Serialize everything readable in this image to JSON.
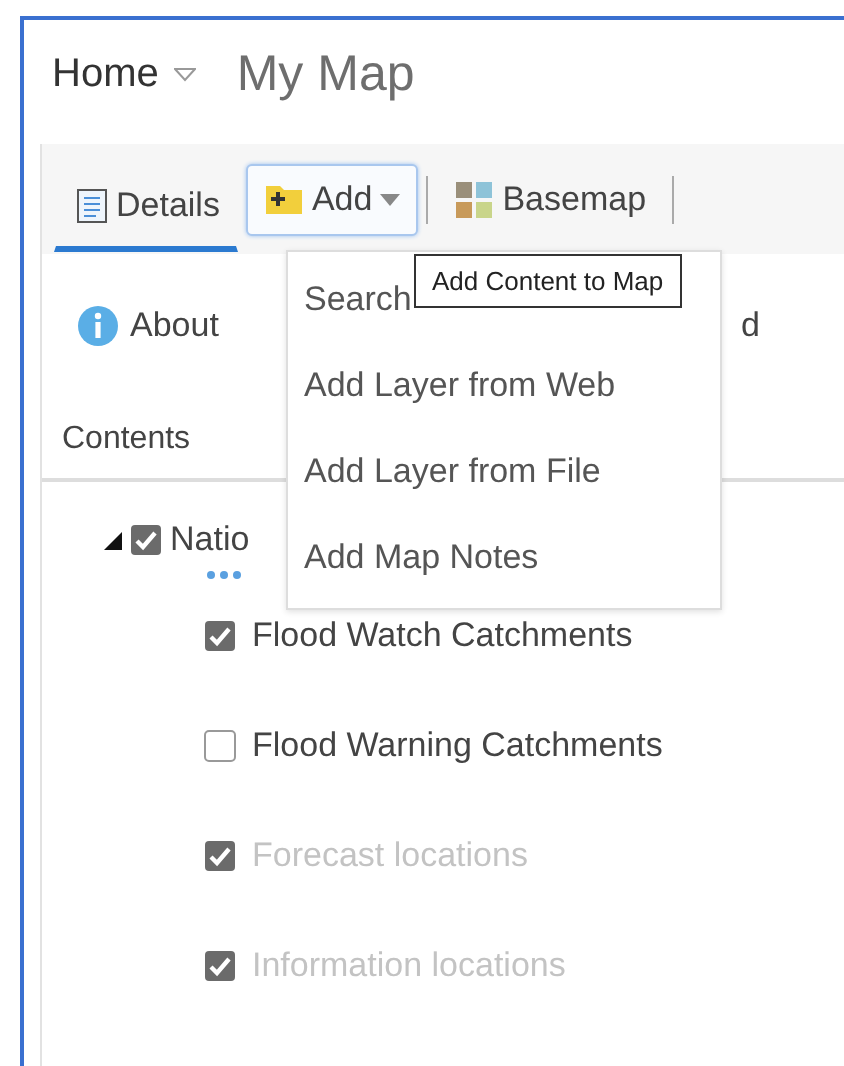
{
  "header": {
    "home": "Home",
    "title": "My Map"
  },
  "toolbar": [
    {
      "kind": "tab",
      "label": "Details",
      "selected": true
    },
    {
      "kind": "dropdown",
      "label": "Add",
      "selected": false,
      "open": true
    },
    {
      "kind": "tab",
      "label": "Basemap",
      "selected": false
    }
  ],
  "about": {
    "label": "About",
    "hidden_tail": "d"
  },
  "contents_label": "Contents",
  "layers": [
    {
      "name": "Natio",
      "checked": true,
      "expanded": true,
      "disabled": false,
      "children": [
        {
          "name": "Flood Watch Catchments",
          "checked": true,
          "disabled": false
        },
        {
          "name": "Flood Warning Catchments",
          "checked": false,
          "disabled": false
        },
        {
          "name": "Forecast locations",
          "checked": true,
          "disabled": true
        },
        {
          "name": "Information locations",
          "checked": true,
          "disabled": true
        }
      ]
    }
  ],
  "add_menu": {
    "items": [
      "Search",
      "Add Layer from Web",
      "Add Layer from File",
      "Add Map Notes"
    ]
  },
  "tooltip": "Add Content to Map"
}
